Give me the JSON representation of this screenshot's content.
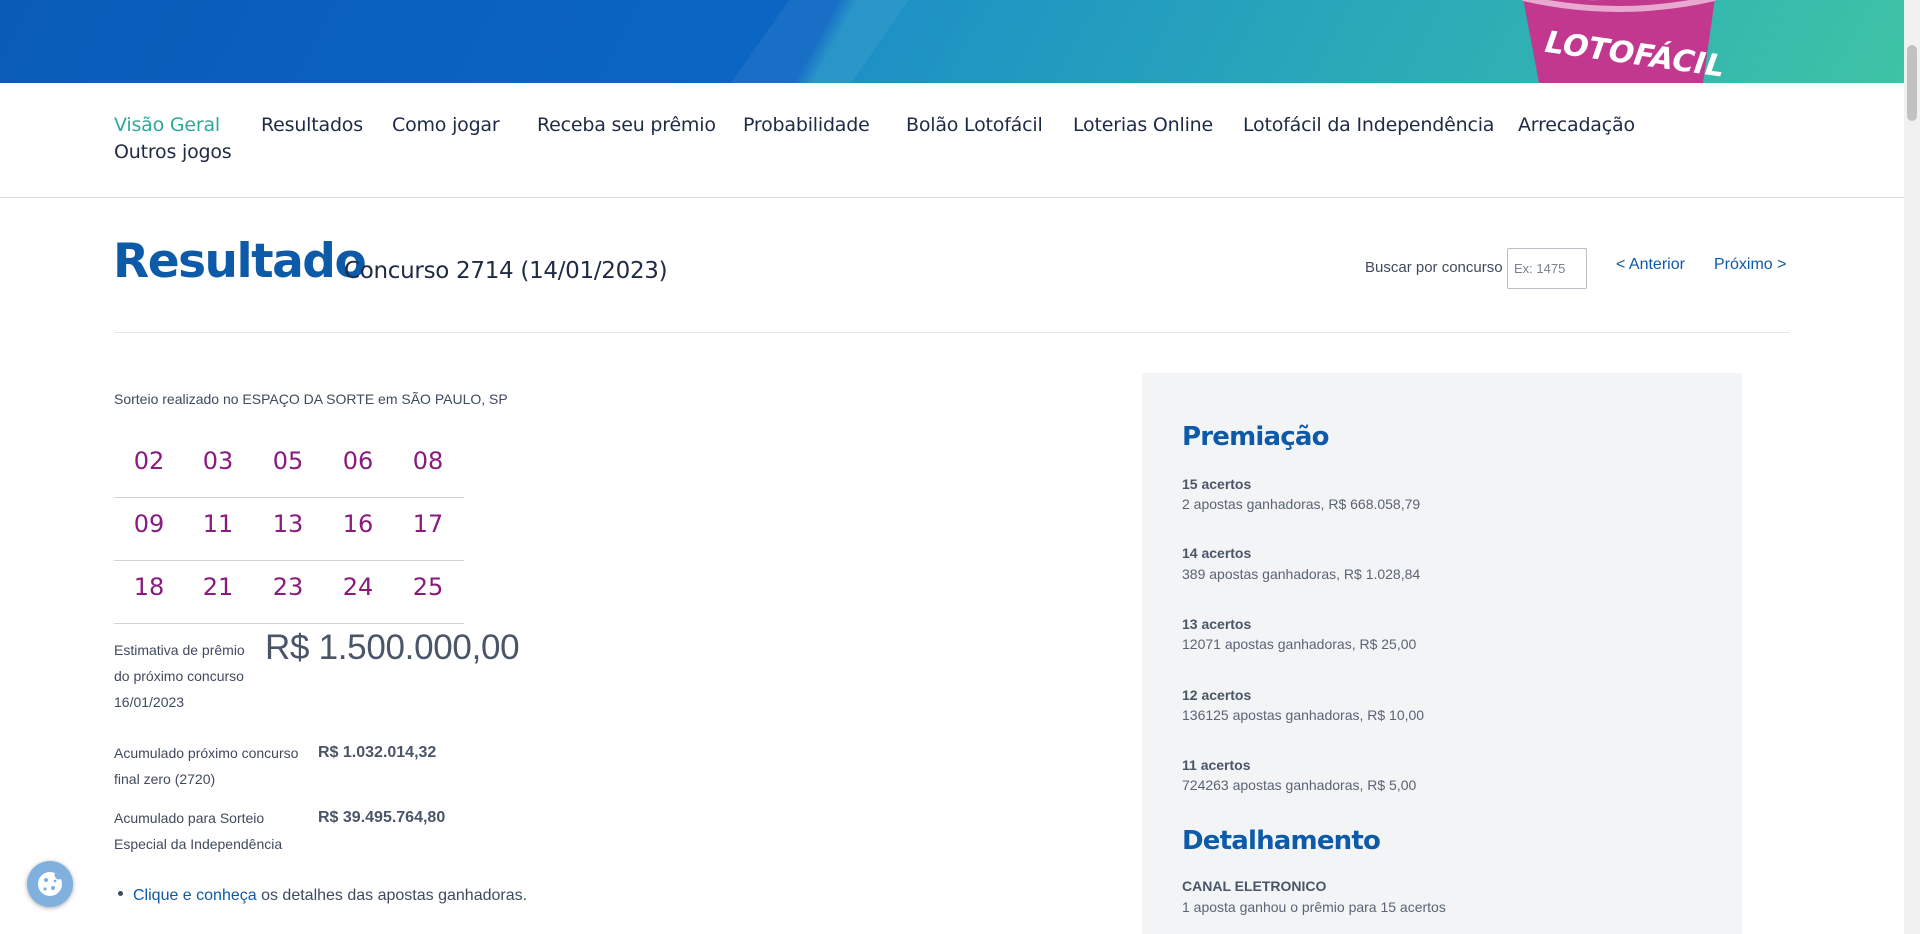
{
  "banner": {
    "logo_text": "LOTOFÁCIL"
  },
  "nav": {
    "items": [
      "Visão Geral",
      "Resultados",
      "Como jogar",
      "Receba seu prêmio",
      "Probabilidade",
      "Bolão Lotofácil",
      "Loterias Online",
      "Lotofácil da Independência",
      "Arrecadação",
      "Outros jogos"
    ],
    "active_index": 0
  },
  "header": {
    "title": "Resultado",
    "subtitle": "Concurso 2714 (14/01/2023)",
    "search_label": "Buscar por concurso",
    "search_placeholder": "Ex: 1475",
    "prev_label": "< Anterior",
    "next_label": "Próximo >"
  },
  "result": {
    "location": "Sorteio realizado no ESPAÇO DA SORTE em SÃO PAULO, SP",
    "numbers": [
      [
        "02",
        "03",
        "05",
        "06",
        "08"
      ],
      [
        "09",
        "11",
        "13",
        "16",
        "17"
      ],
      [
        "18",
        "21",
        "23",
        "24",
        "25"
      ]
    ],
    "estimate": {
      "label": [
        "Estimativa de prêmio",
        "do próximo concurso",
        "16/01/2023"
      ],
      "value": "R$ 1.500.000,00"
    },
    "accumulated": [
      {
        "label": [
          "Acumulado próximo concurso",
          "final zero (2720)"
        ],
        "value": "R$ 1.032.014,32"
      },
      {
        "label": [
          "Acumulado para Sorteio",
          "Especial da Independência"
        ],
        "value": "R$ 39.495.764,80"
      }
    ],
    "details_link": "Clique e conheça",
    "details_text": " os detalhes das apostas ganhadoras."
  },
  "panel": {
    "prizes_title": "Premiação",
    "prizes": [
      {
        "tier": "15 acertos",
        "desc": "2 apostas ganhadoras, R$ 668.058,79"
      },
      {
        "tier": "14 acertos",
        "desc": "389 apostas ganhadoras, R$ 1.028,84"
      },
      {
        "tier": "13 acertos",
        "desc": "12071 apostas ganhadoras, R$ 25,00"
      },
      {
        "tier": "12 acertos",
        "desc": "136125 apostas ganhadoras, R$ 10,00"
      },
      {
        "tier": "11 acertos",
        "desc": "724263 apostas ganhadoras, R$ 5,00"
      }
    ],
    "details_title": "Detalhamento",
    "channel": "CANAL ELETRONICO",
    "channel_desc": "1 aposta ganhou o prêmio para 15 acertos"
  },
  "colors": {
    "brand_blue": "#0c5aa8",
    "active_nav": "#2fa89b",
    "ball_number": "#8a1a7e",
    "panel_bg": "#f3f4f6"
  },
  "icons": {
    "cookie": "cookie-icon"
  }
}
